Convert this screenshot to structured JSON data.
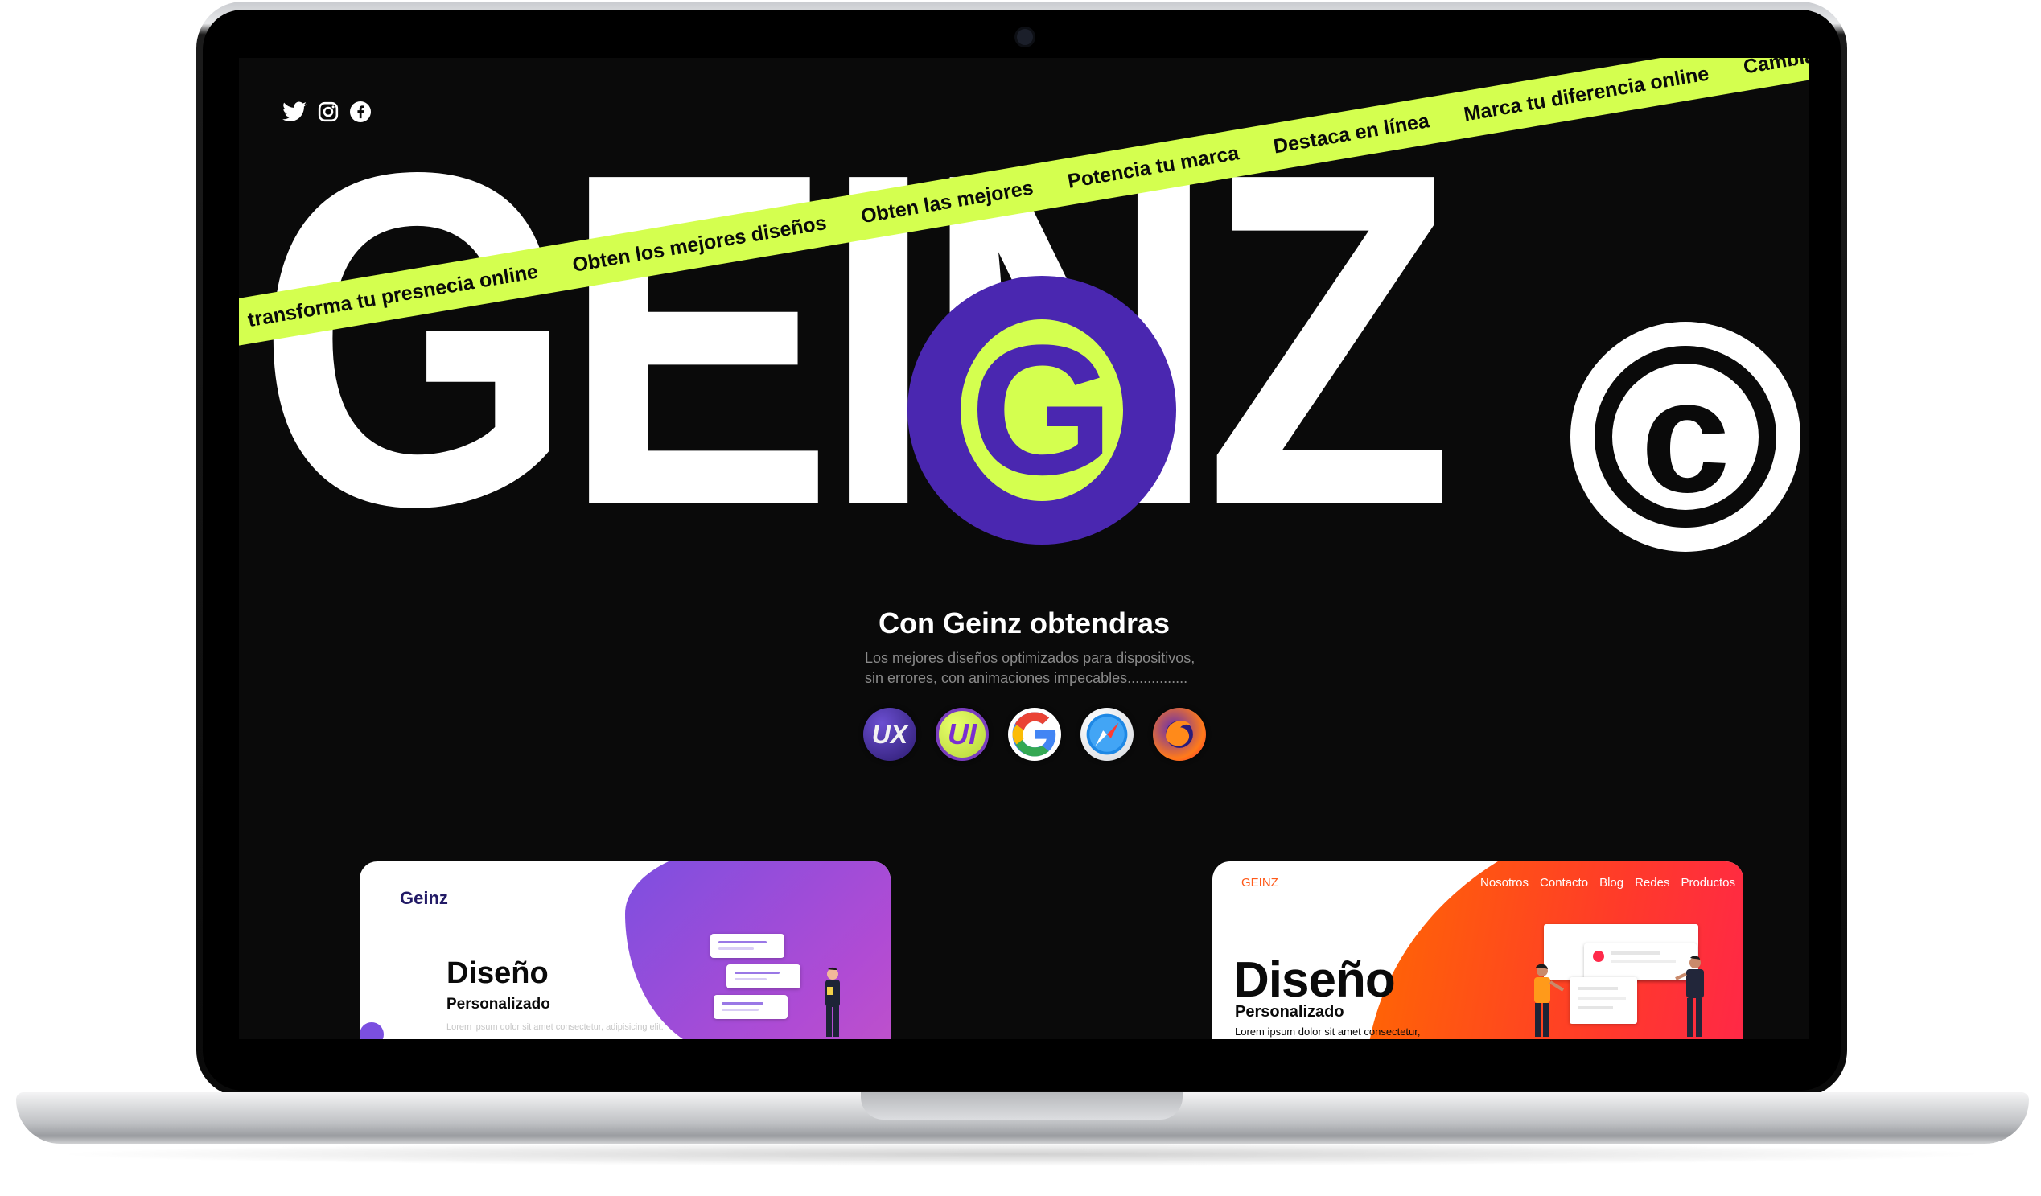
{
  "social": {
    "icons": [
      "twitter-icon",
      "instagram-icon",
      "facebook-icon"
    ]
  },
  "hero": {
    "logo_text": "GEINZ",
    "copyright_glyph": "c",
    "badge_letter": "G",
    "ribbon_items": [
      "transforma tu presnecia online",
      "Obten los mejores diseños",
      "Obten las mejores",
      "Potencia tu marca",
      "Destaca en línea",
      "Marca tu diferencia online",
      "Cambia"
    ]
  },
  "features": {
    "title": "Con Geinz obtendras",
    "description_line1": "Los mejores diseños optimizados para dispositivos,",
    "description_line2": "sin errores, con animaciones impecables...............",
    "tech_badges": [
      {
        "label": "UX",
        "icon": "ux-icon"
      },
      {
        "label": "UI",
        "icon": "ui-icon"
      },
      {
        "label": "",
        "icon": "google-chrome-icon"
      },
      {
        "label": "",
        "icon": "safari-icon"
      },
      {
        "label": "",
        "icon": "firefox-icon"
      }
    ]
  },
  "card1": {
    "logo": "Geinz",
    "heading": "Diseño",
    "subheading": "Personalizado",
    "body": "Lorem ipsum dolor sit amet consectetur, adipisicing elit."
  },
  "card2": {
    "logo": "GEINZ",
    "nav": [
      "Nosotros",
      "Contacto",
      "Blog",
      "Redes",
      "Productos"
    ],
    "heading": "Diseño",
    "subheading": "Personalizado",
    "body": "Lorem ipsum dolor sit amet consectetur,"
  },
  "colors": {
    "accent_lime": "#d4ff4f",
    "accent_purple": "#4a27b0",
    "background": "#0a0a0a",
    "text": "#ffffff"
  }
}
